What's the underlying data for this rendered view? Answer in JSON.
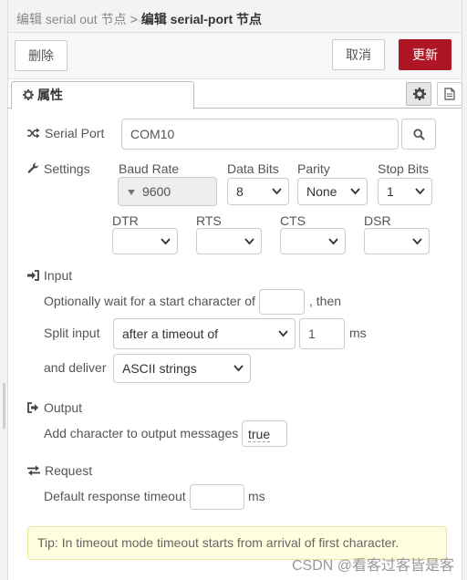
{
  "breadcrumb": {
    "parent": "编辑 serial out 节点",
    "separator": ">",
    "current": "编辑 serial-port 节点"
  },
  "actions": {
    "delete": "删除",
    "cancel": "取消",
    "done": "更新"
  },
  "tabs": {
    "properties": "属性"
  },
  "serial_port": {
    "label": "Serial Port",
    "value": "COM10"
  },
  "settings": {
    "label": "Settings",
    "baud_rate": {
      "label": "Baud Rate",
      "value": "9600"
    },
    "data_bits": {
      "label": "Data Bits",
      "value": "8"
    },
    "parity": {
      "label": "Parity",
      "value": "None"
    },
    "stop_bits": {
      "label": "Stop Bits",
      "value": "1"
    },
    "dtr": {
      "label": "DTR",
      "value": ""
    },
    "rts": {
      "label": "RTS",
      "value": ""
    },
    "cts": {
      "label": "CTS",
      "value": ""
    },
    "dsr": {
      "label": "DSR",
      "value": ""
    }
  },
  "input": {
    "label": "Input",
    "wait_text": "Optionally wait for a start character of",
    "wait_suffix": ", then",
    "wait_value": "",
    "split_label": "Split input",
    "split_value": "after a timeout of",
    "split_amount": "1",
    "split_unit": "ms",
    "deliver_label": "and deliver",
    "deliver_value": "ASCII strings"
  },
  "output": {
    "label": "Output",
    "add_char_text": "Add character to output messages",
    "add_char_value": "true"
  },
  "request": {
    "label": "Request",
    "timeout_text": "Default response timeout",
    "timeout_value": "",
    "timeout_unit": "ms"
  },
  "tip": "Tip: In timeout mode timeout starts from arrival of first character.",
  "watermark": "CSDN @看客过客皆是客",
  "colors": {
    "primary": "#ad1625",
    "tip_bg": "#ffffe0"
  },
  "icons": {
    "tab": "gear-icon",
    "tab_side_1": "gear-icon",
    "tab_side_2": "document-icon",
    "serial_port": "shuffle-icon",
    "settings": "wrench-icon",
    "input": "sign-in-icon",
    "output": "sign-out-icon",
    "request": "exchange-icon",
    "search": "search-icon"
  }
}
